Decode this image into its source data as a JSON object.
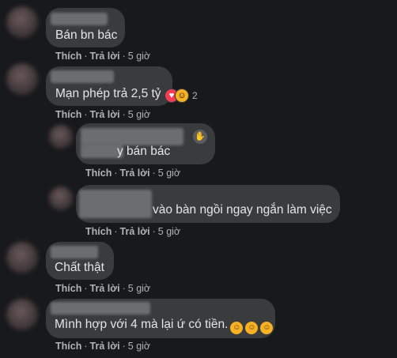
{
  "comments": [
    {
      "text": "Bán bn bác",
      "actions": {
        "like": "Thích",
        "reply": "Trả lời",
        "time": "5 giờ"
      }
    },
    {
      "text": "Mạn phép trả 2,5 tỷ",
      "reactions": {
        "icons": [
          "love-icon",
          "haha-icon"
        ],
        "count": "2"
      },
      "actions": {
        "like": "Thích",
        "reply": "Trả lời",
        "time": "5 giờ"
      }
    },
    {
      "text": "y bán bác",
      "actions": {
        "like": "Thích",
        "reply": "Trả lời",
        "time": "5 giờ"
      }
    },
    {
      "text": "vào bàn ngồi ngay ngắn làm việc",
      "actions": {
        "like": "Thích",
        "reply": "Trả lời",
        "time": "5 giờ"
      }
    },
    {
      "text": "Chất thật",
      "actions": {
        "like": "Thích",
        "reply": "Trả lời",
        "time": "5 giờ"
      }
    },
    {
      "text": "Mình hợp với 4 mà lại ứ có tiền.",
      "emoji": [
        "haha-icon",
        "haha-icon",
        "haha-icon"
      ],
      "actions": {
        "like": "Thích",
        "reply": "Trả lời",
        "time": "5 giờ"
      }
    }
  ],
  "separator": "·",
  "colors": {
    "background": "#18191a",
    "bubble": "#3a3b3c",
    "text": "#e4e6eb",
    "meta": "#b0b3b8",
    "love": "#f33e58",
    "haha": "#f7b125"
  }
}
